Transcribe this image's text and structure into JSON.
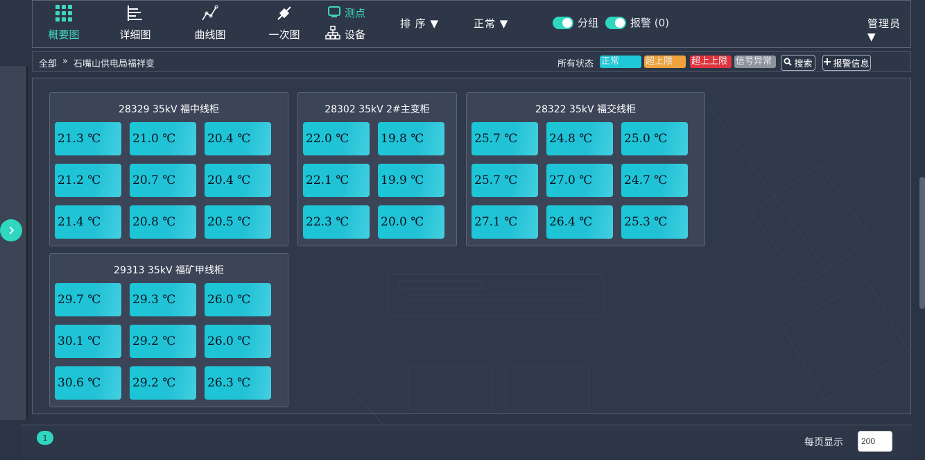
{
  "nav": {
    "items": [
      {
        "label": "概要图",
        "icon": "grid-icon"
      },
      {
        "label": "详细图",
        "icon": "bar-list-icon"
      },
      {
        "label": "曲线图",
        "icon": "line-chart-icon"
      },
      {
        "label": "一次图",
        "icon": "plug-icon"
      }
    ],
    "point_label": "测点",
    "device_label": "设备",
    "sort_label": "排 序 ▼",
    "normal_label": "正常 ▼",
    "group_toggle_label": "分组",
    "alarm_toggle_label": "报警 (0)",
    "user_label": "管理员 ▼"
  },
  "crumb": {
    "root": "全部",
    "sep": "»",
    "station": "石嘴山供电局福祥变"
  },
  "status": {
    "label": "所有状态",
    "chips": [
      {
        "label": "正常",
        "color": "#1fc8d6"
      },
      {
        "label": "超上限",
        "color": "#f0a23a"
      },
      {
        "label": "超上上限",
        "color": "#e0343c"
      },
      {
        "label": "信号异常",
        "color": "#8e949c"
      }
    ],
    "search_label": "搜索",
    "alarm_info_label": "报警信息"
  },
  "groups": [
    {
      "title": "28329 35kV 福中线柜",
      "values": [
        "21.3 ℃",
        "21.0 ℃",
        "20.4 ℃",
        "21.2 ℃",
        "20.7 ℃",
        "20.4 ℃",
        "21.4 ℃",
        "20.8 ℃",
        "20.5 ℃"
      ]
    },
    {
      "title": "28302 35kV 2#主变柜",
      "values": [
        "22.0 ℃",
        "19.8 ℃",
        "22.1 ℃",
        "19.9 ℃",
        "22.3 ℃",
        "20.0 ℃"
      ]
    },
    {
      "title": "28322 35kV 福交线柜",
      "values": [
        "25.7 ℃",
        "24.8 ℃",
        "25.0 ℃",
        "25.7 ℃",
        "27.0 ℃",
        "24.7 ℃",
        "27.1 ℃",
        "26.4 ℃",
        "25.3 ℃"
      ]
    },
    {
      "title": "29313 35kV 福矿甲线柜",
      "values": [
        "29.7 ℃",
        "29.3 ℃",
        "26.0 ℃",
        "30.1 ℃",
        "29.2 ℃",
        "26.0 ℃",
        "30.6 ℃",
        "29.2 ℃",
        "26.3 ℃"
      ]
    }
  ],
  "footer": {
    "page": "1",
    "per_page_label": "每页显示",
    "per_page_value": "200"
  },
  "colors": {
    "accent": "#2fd7bf",
    "tile": "#1bc7d6"
  }
}
